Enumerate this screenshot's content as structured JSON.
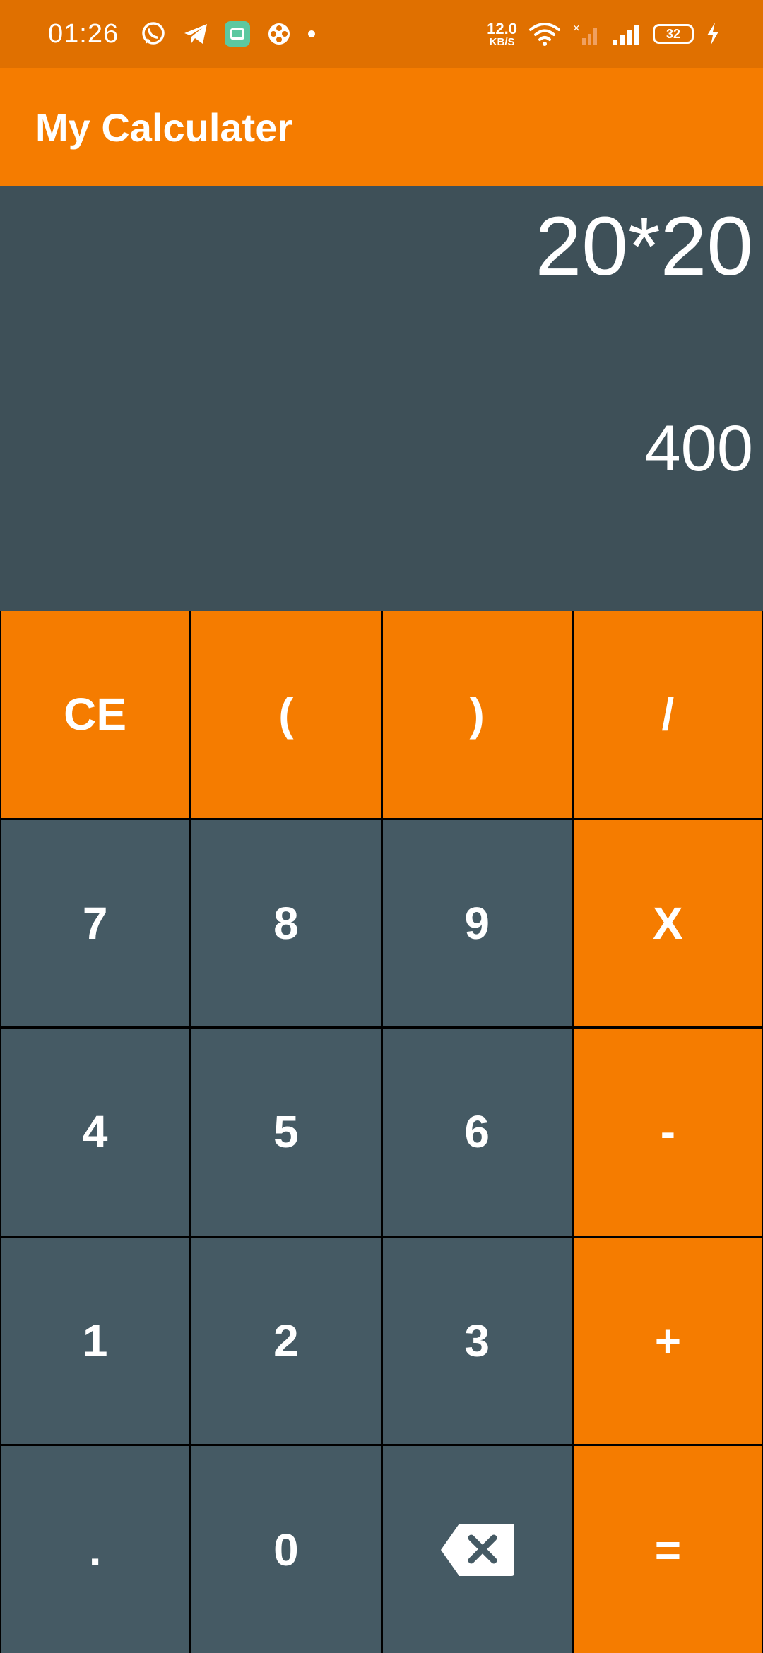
{
  "status_bar": {
    "time": "01:26",
    "net_speed_value": "12.0",
    "net_speed_unit": "KB/S",
    "battery": "32",
    "icons": [
      "whatsapp-icon",
      "telegram-icon",
      "app-icon",
      "film-reel-icon",
      "notification-dot",
      "wifi-icon",
      "signal-no-service-icon",
      "signal-icon",
      "battery-icon",
      "charging-icon"
    ]
  },
  "app_bar": {
    "title": "My Calculater"
  },
  "display": {
    "expression": "20*20",
    "result": "400"
  },
  "keypad": {
    "rows": [
      [
        "CE",
        "(",
        ")",
        "/"
      ],
      [
        "7",
        "8",
        "9",
        "X"
      ],
      [
        "4",
        "5",
        "6",
        "-"
      ],
      [
        "1",
        "2",
        "3",
        "+"
      ],
      [
        ".",
        "0",
        "backspace-icon",
        "="
      ]
    ]
  },
  "colors": {
    "status_bar": "#E07000",
    "primary_orange": "#F57C00",
    "display_bg": "#3E5058",
    "key_slate": "#455A64",
    "grid_line": "#000000"
  }
}
